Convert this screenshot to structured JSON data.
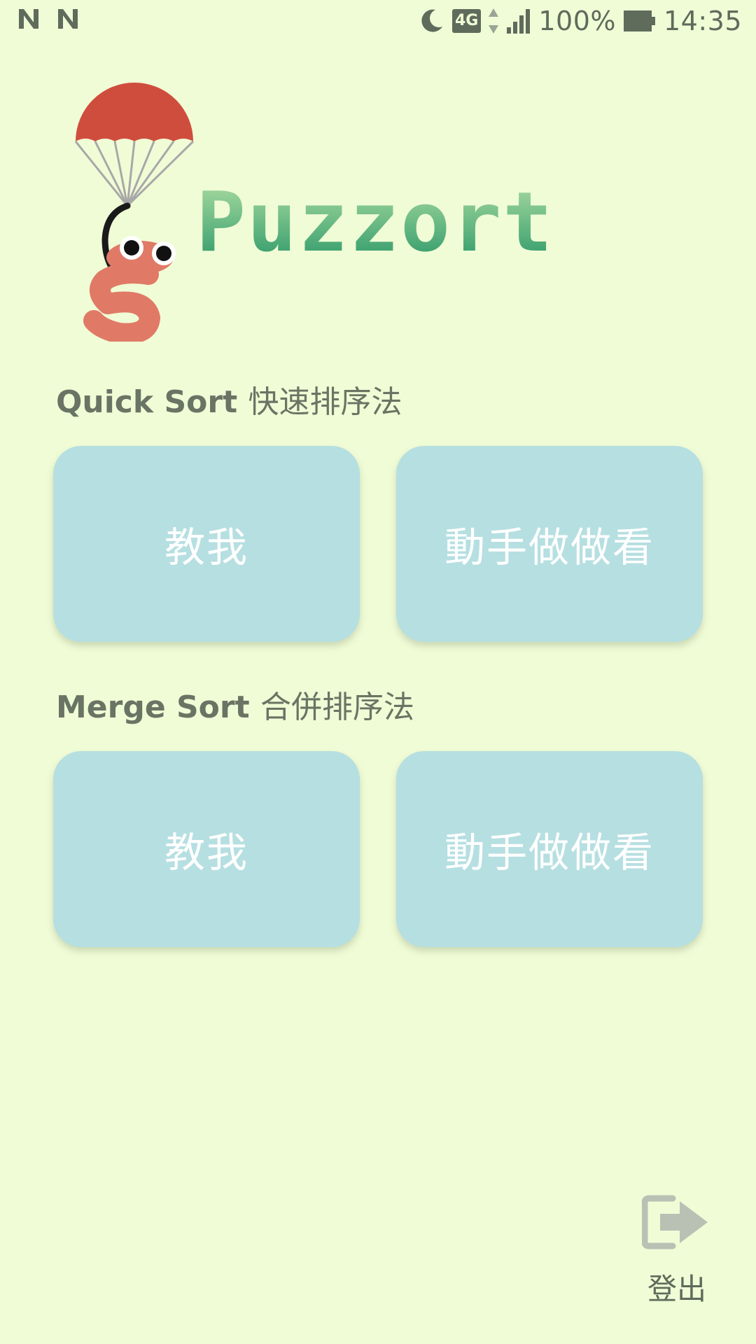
{
  "status_bar": {
    "net_type": "4G",
    "battery": "100%",
    "time": "14:35",
    "icons": [
      "notification-n-icon",
      "notification-n-icon",
      "moon-icon",
      "data-arrows-icon",
      "signal-icon",
      "battery-icon"
    ]
  },
  "logo": {
    "wordmark": "Puzzort",
    "letter": "S",
    "colors": {
      "canopy": "#cf4d3d",
      "worm": "#e07a66",
      "word_top": "#a9dba0",
      "word_bottom": "#2f9a6a"
    }
  },
  "sections": [
    {
      "title_en": "Quick Sort",
      "title_zh": "快速排序法",
      "buttons": [
        {
          "label": "教我"
        },
        {
          "label": "動手做做看"
        }
      ]
    },
    {
      "title_en": "Merge Sort",
      "title_zh": "合併排序法",
      "buttons": [
        {
          "label": "教我"
        },
        {
          "label": "動手做做看"
        }
      ]
    }
  ],
  "logout": {
    "label": "登出"
  },
  "colors": {
    "background": "#f0fcd6",
    "button": "#b6dfe1",
    "text": "#6a7464"
  }
}
